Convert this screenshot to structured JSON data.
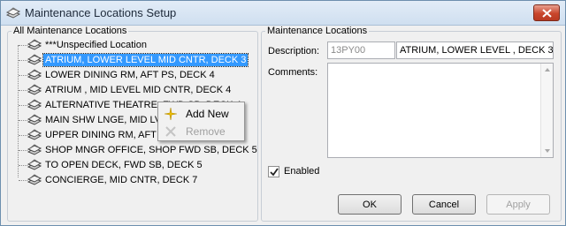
{
  "window": {
    "title": "Maintenance Locations Setup"
  },
  "left_panel": {
    "legend": "All Maintenance Locations",
    "items": [
      {
        "label": "***Unspecified Location"
      },
      {
        "label": "ATRIUM, LOWER LEVEL MID CNTR, DECK 3",
        "selected": true
      },
      {
        "label": "LOWER DINING RM,  AFT PS, DECK 4"
      },
      {
        "label": "ATRIUM , MID LEVEL MID CNTR, DECK 4"
      },
      {
        "label": "ALTERNATIVE THEATRE,  FWD SB, DECK 4"
      },
      {
        "label": "MAIN SHW LNGE, MID LVL FWD, DECK 4"
      },
      {
        "label": "UPPER DINING RM,  AFT SB, DECK 5"
      },
      {
        "label": "SHOP MNGR OFFICE, SHOP FWD SB, DECK 5"
      },
      {
        "label": "TO OPEN DECK,  FWD SB, DECK 5"
      },
      {
        "label": "CONCIERGE,  MID CNTR, DECK 7"
      }
    ]
  },
  "context_menu": {
    "add_label": "Add New",
    "remove_label": "Remove"
  },
  "right_panel": {
    "legend": "Maintenance Locations",
    "description_label": "Description:",
    "code_value": "13PY00",
    "description_value": "ATRIUM, LOWER LEVEL , DECK 3",
    "comments_label": "Comments:",
    "comments_value": "",
    "enabled_label": "Enabled",
    "enabled": true
  },
  "buttons": {
    "ok": "OK",
    "cancel": "Cancel",
    "apply": "Apply"
  },
  "colors": {
    "selection": "#3399ff",
    "title_bar": "#cfdff0",
    "close_button": "#c9462c"
  },
  "icons": {
    "title": "stacked-pages-icon",
    "tree_item": "stacked-pages-icon",
    "add": "sparkle-icon",
    "remove": "x-icon"
  }
}
